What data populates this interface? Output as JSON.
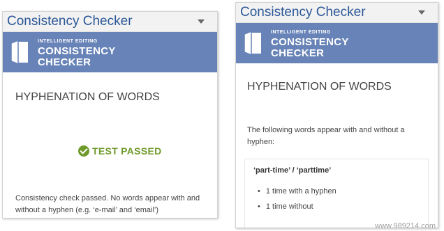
{
  "panes": {
    "left": {
      "title": "Consistency Checker",
      "brand_small": "INTELLIGENT EDITING",
      "brand_line1": "CONSISTENCY",
      "brand_line2": "CHECKER",
      "section_heading": "HYPHENATION OF WORDS",
      "result_label": "TEST PASSED",
      "result_icon": "check-circle-icon",
      "message_line1": "Consistency check passed. No words appear with and",
      "message_line2": "without a hyphen (e.g. ‘e-mail’ and ‘email’)"
    },
    "right": {
      "title": "Consistency Checker",
      "brand_small": "INTELLIGENT EDITING",
      "brand_line1": "CONSISTENCY",
      "brand_line2": "CHECKER",
      "section_heading": "HYPHENATION OF WORDS",
      "intro_line1": "The following words appear with and without a",
      "intro_line2": "hyphen:",
      "word_pair": "‘part-time’ / ‘parttime’",
      "occurrences": [
        "1 time with a hyphen",
        "1 time without"
      ]
    }
  },
  "colors": {
    "title_blue": "#2b5797",
    "banner_blue": "#6783b7",
    "pass_green": "#6f9a2a"
  },
  "watermark": "www.989214.com"
}
